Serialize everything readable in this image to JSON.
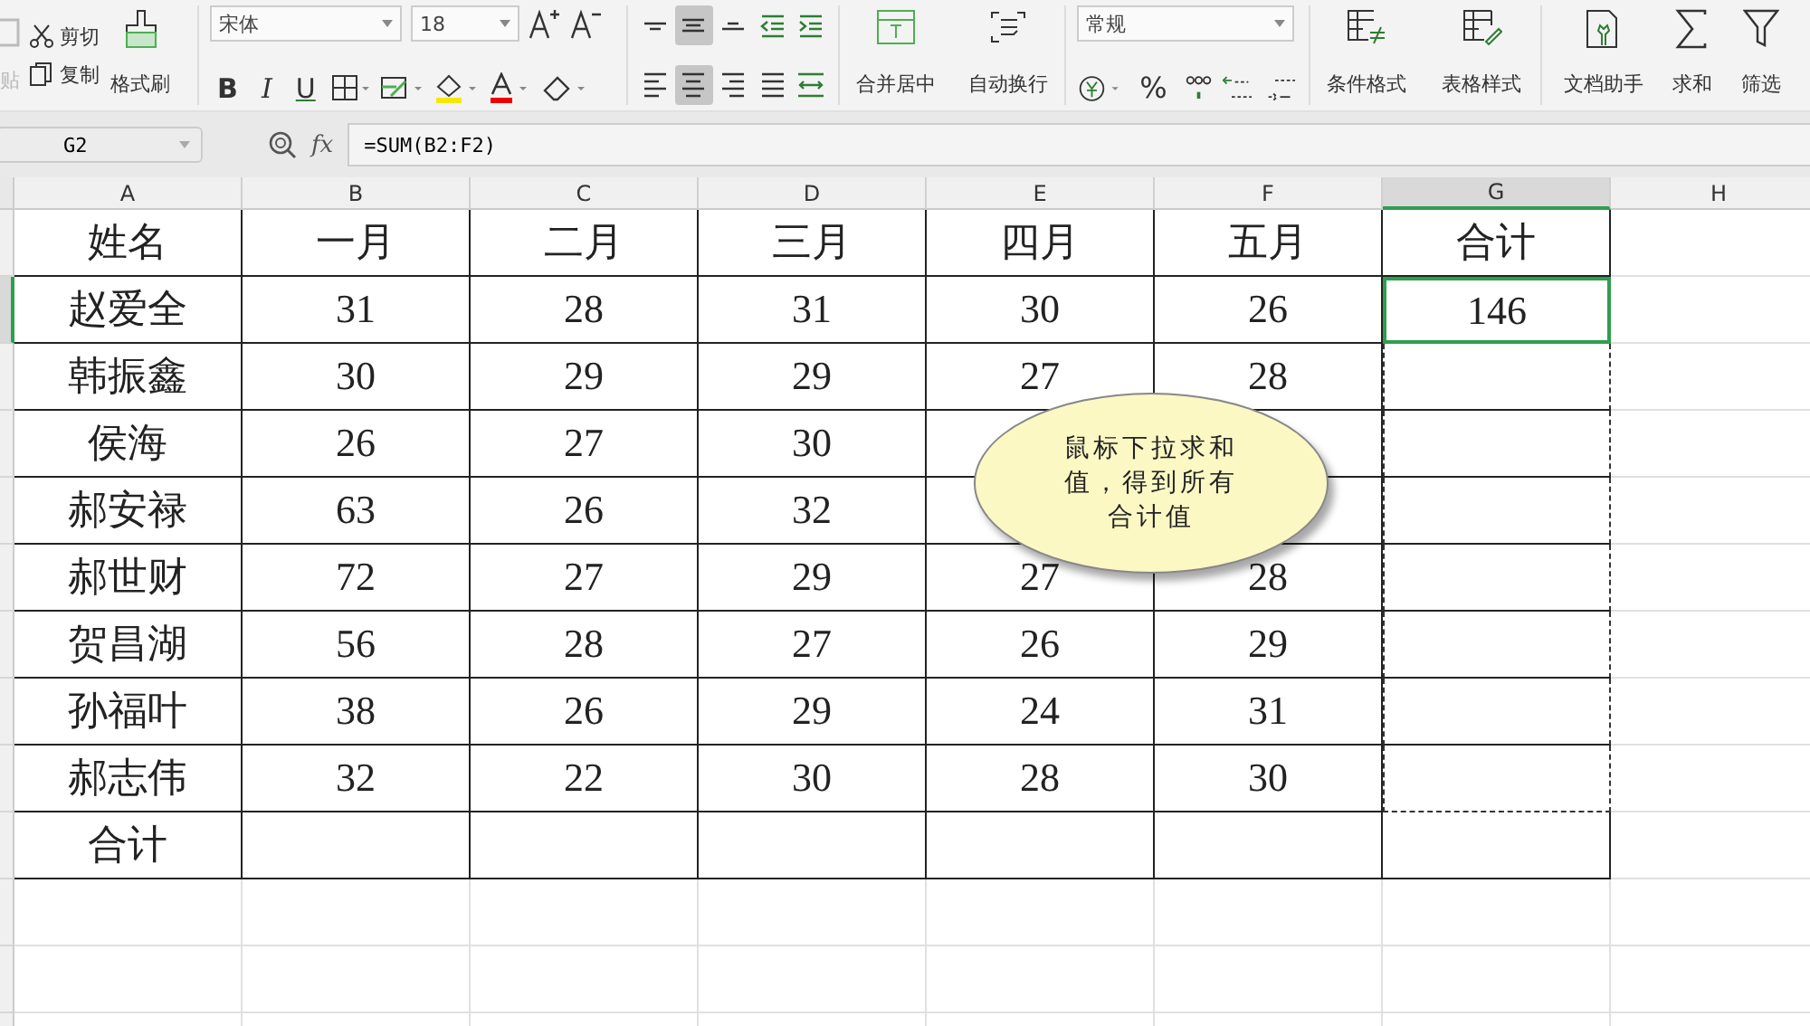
{
  "ribbon": {
    "paste": {
      "label": "贴",
      "disabled": true
    },
    "cut": "剪切",
    "copy": "复制",
    "format_painter": "格式刷",
    "font_name": "宋体",
    "font_size": "18",
    "bold": "B",
    "italic": "I",
    "underline": "U",
    "align_top_row": [
      {
        "kind": "top",
        "selected": false
      },
      {
        "kind": "middle",
        "selected": true
      },
      {
        "kind": "bottom",
        "selected": false
      },
      {
        "kind": "outdent",
        "selected": false
      },
      {
        "kind": "indent",
        "selected": false
      }
    ],
    "align_bottom_row": [
      {
        "kind": "left",
        "selected": false
      },
      {
        "kind": "center",
        "selected": true
      },
      {
        "kind": "right",
        "selected": false
      },
      {
        "kind": "justify",
        "selected": false
      },
      {
        "kind": "distribute",
        "selected": false
      }
    ],
    "merge_center": "合并居中",
    "wrap_text": "自动换行",
    "number_format": "常规",
    "percent": "%",
    "conditional_format": "条件格式",
    "table_style": "表格样式",
    "doc_assistant": "文档助手",
    "sum": "求和",
    "filter": "筛选"
  },
  "formula_bar": {
    "name_box": "G2",
    "fx": "fx",
    "formula": "=SUM(B2:F2)"
  },
  "columns": [
    {
      "label": "A",
      "selected": false
    },
    {
      "label": "B",
      "selected": false
    },
    {
      "label": "C",
      "selected": false
    },
    {
      "label": "D",
      "selected": false
    },
    {
      "label": "E",
      "selected": false
    },
    {
      "label": "F",
      "selected": false
    },
    {
      "label": "G",
      "selected": true
    },
    {
      "label": "H",
      "selected": false
    }
  ],
  "rows": [
    {
      "selected": false,
      "in_fill_range": false,
      "cells": [
        "姓名",
        "一月",
        "二月",
        "三月",
        "四月",
        "五月",
        "合计"
      ]
    },
    {
      "selected": true,
      "in_fill_range": true,
      "cells": [
        "赵爱全",
        "31",
        "28",
        "31",
        "30",
        "26",
        "146"
      ]
    },
    {
      "selected": false,
      "in_fill_range": true,
      "cells": [
        "韩振鑫",
        "30",
        "29",
        "29",
        "27",
        "28",
        null
      ]
    },
    {
      "selected": false,
      "in_fill_range": true,
      "cells": [
        "侯海",
        "26",
        "27",
        "30",
        null,
        null,
        null
      ]
    },
    {
      "selected": false,
      "in_fill_range": true,
      "cells": [
        "郝安禄",
        "63",
        "26",
        "32",
        null,
        null,
        null
      ]
    },
    {
      "selected": false,
      "in_fill_range": true,
      "cells": [
        "郝世财",
        "72",
        "27",
        "29",
        "27",
        "28",
        null
      ]
    },
    {
      "selected": false,
      "in_fill_range": true,
      "cells": [
        "贺昌湖",
        "56",
        "28",
        "27",
        "26",
        "29",
        null
      ]
    },
    {
      "selected": false,
      "in_fill_range": true,
      "cells": [
        "孙福叶",
        "38",
        "26",
        "29",
        "24",
        "31",
        null
      ]
    },
    {
      "selected": false,
      "in_fill_range": true,
      "cells": [
        "郝志伟",
        "32",
        "22",
        "30",
        "28",
        "30",
        null
      ]
    },
    {
      "selected": false,
      "in_fill_range": false,
      "cells": [
        "合计",
        null,
        null,
        null,
        null,
        null,
        null
      ]
    }
  ],
  "callout": {
    "text": "鼠标下拉求和值，得到所有合计值"
  }
}
